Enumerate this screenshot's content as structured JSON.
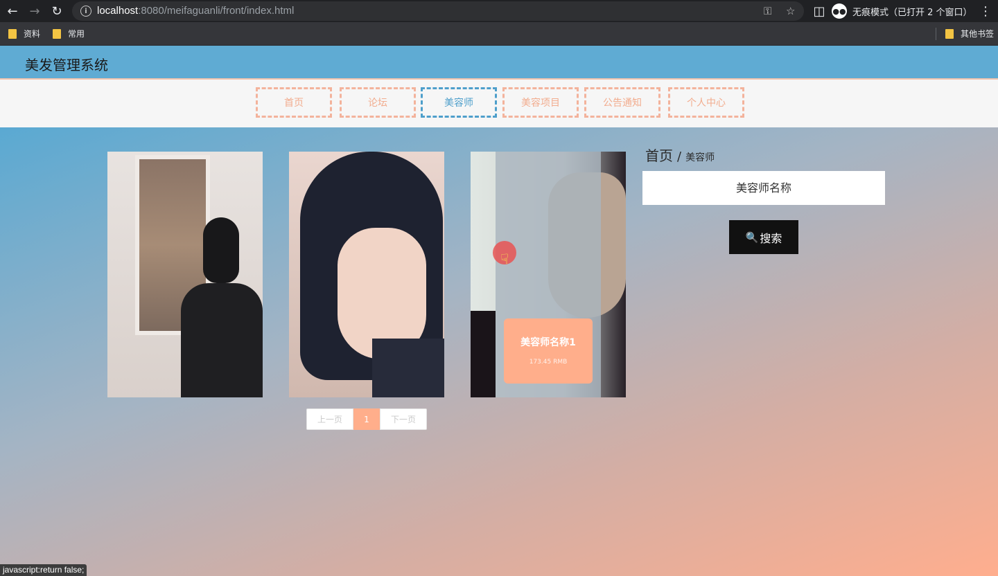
{
  "browser": {
    "url_host": "localhost",
    "url_rest": ":8080/meifaguanli/front/index.html",
    "incognito_label": "无痕模式（已打开 2 个窗口）",
    "bookmarks": [
      "资料",
      "常用"
    ],
    "other_bookmarks": "其他书签",
    "status_text": "javascript:return false;"
  },
  "site": {
    "title": "美发管理系统",
    "header_color": "#5fabd3",
    "accent_color": "#ffae8b"
  },
  "nav": {
    "items": [
      "首页",
      "论坛",
      "美容师",
      "美容项目",
      "公告通知",
      "个人中心"
    ],
    "active_index": 2
  },
  "cards": [
    {
      "name": "美容师名称1",
      "price": "173.45 RMB"
    }
  ],
  "pagination": {
    "prev": "上一页",
    "current": "1",
    "next": "下一页"
  },
  "breadcrumb": {
    "home": "首页",
    "separator": "/",
    "current": "美容师"
  },
  "search": {
    "placeholder": "美容师名称",
    "button_label": "搜索"
  }
}
